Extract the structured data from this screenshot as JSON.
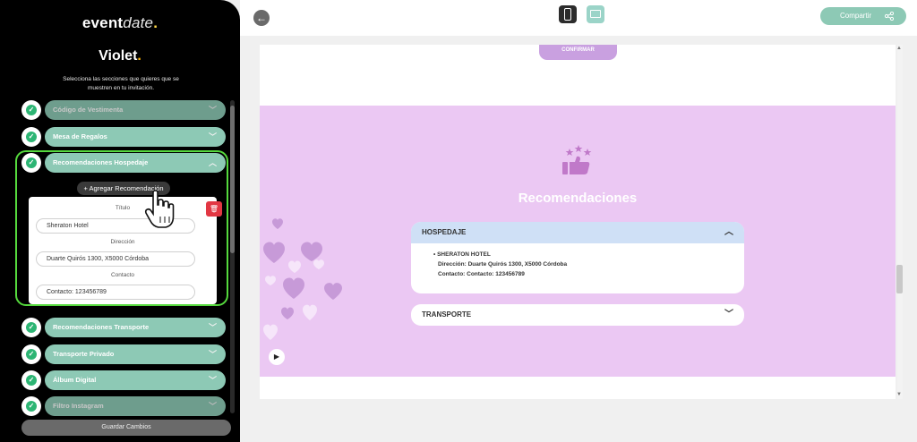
{
  "sidebar": {
    "brand_a": "event",
    "brand_b": "date",
    "brand_dot": ".",
    "event_name": "Violet",
    "event_dot": ".",
    "instructions": "Selecciona las secciones que quieres que se muestren en tu invitación.",
    "sections_top": [
      {
        "label": "Código de Vestimenta"
      },
      {
        "label": "Mesa de Regalos"
      },
      {
        "label": "Recomendaciones Hospedaje"
      }
    ],
    "add_button": "+ Agregar Recomendación",
    "card": {
      "title_label": "Título",
      "title_value": "Sheraton Hotel",
      "address_label": "Dirección",
      "address_value": "Duarte Quirós 1300, X5000 Córdoba",
      "contact_label": "Contacto",
      "contact_value": "Contacto: 123456789"
    },
    "sections_bottom": [
      {
        "label": "Recomendaciones Transporte"
      },
      {
        "label": "Transporte Privado"
      },
      {
        "label": "Álbum Digital"
      },
      {
        "label": "Filtro Instagram"
      }
    ],
    "save_button": "Guardar Cambios"
  },
  "topbar": {
    "share_label": "Compartir",
    "active_device": "mobile"
  },
  "preview": {
    "confirm_label": "CONFIRMAR",
    "section_title": "Recomendaciones",
    "accordion_open": {
      "label": "HOSPEDAJE",
      "item_name": "SHERATON HOTEL",
      "item_address": "Dirección: Duarte Quirós 1300, X5000 Córdoba",
      "item_contact": "Contacto: Contacto: 123456789"
    },
    "accordion_closed": {
      "label": "TRANSPORTE"
    }
  },
  "colors": {
    "accent_teal": "#8dc9b5",
    "check_green": "#2db574",
    "highlight_green": "#55d93d",
    "preview_purple": "#ebc8f3",
    "delete_red": "#e23743"
  }
}
